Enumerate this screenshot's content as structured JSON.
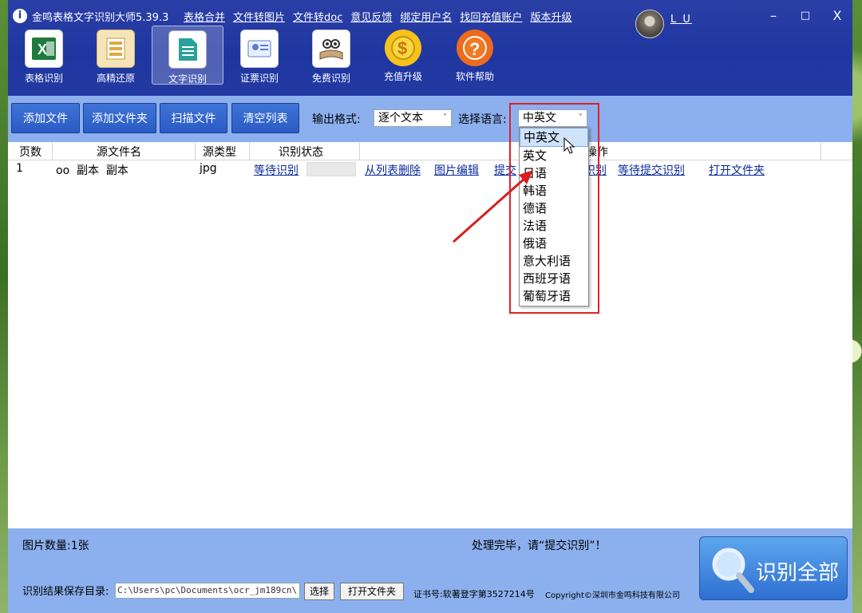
{
  "app": {
    "title": "金鸣表格文字识别大师5.39.3",
    "menu": [
      "表格合并",
      "文件转图片",
      "文件转doc",
      "意见反馈",
      "绑定用户名",
      "找回充值账户",
      "版本升级"
    ],
    "username": "L U",
    "window_buttons": {
      "minimize": "–",
      "maximize": "□",
      "close": "X"
    }
  },
  "tools": [
    {
      "label": "表格识别",
      "icon": "excel-icon"
    },
    {
      "label": "高精还原",
      "icon": "restore-icon"
    },
    {
      "label": "文字识别",
      "icon": "text-doc-icon",
      "active": true
    },
    {
      "label": "证票识别",
      "icon": "id-card-icon"
    },
    {
      "label": "免费识别",
      "icon": "book-owl-icon"
    },
    {
      "label": "充值升级",
      "icon": "coin-icon"
    },
    {
      "label": "软件帮助",
      "icon": "help-icon"
    }
  ],
  "actions": {
    "add_file": "添加文件",
    "add_folder": "添加文件夹",
    "scan_file": "扫描文件",
    "clear_list": "清空列表",
    "output_format_label": "输出格式:",
    "output_format_value": "逐个文本",
    "language_label": "选择语言:",
    "language_value": "中英文"
  },
  "table": {
    "headers": [
      "页数",
      "源文件名",
      "源类型",
      "识别状态",
      "操作"
    ],
    "rows": [
      {
        "page": "1",
        "name": "oo  副本  副本",
        "type": "jpg",
        "status": "等待识别",
        "ops": [
          "从列表删除",
          "图片编辑",
          "提交",
          "识别",
          "等待提交识别",
          "打开文件夹"
        ]
      }
    ]
  },
  "language_options": [
    "中英文",
    "英文",
    "日语",
    "韩语",
    "德语",
    "法语",
    "俄语",
    "意大利语",
    "西班牙语",
    "葡萄牙语"
  ],
  "footer": {
    "image_count": "图片数量:1张",
    "status_message": "处理完毕，请“提交识别”！",
    "save_dir_label": "识别结果保存目录:",
    "save_dir_value": "C:\\Users\\pc\\Documents\\ocr_jm189cn\\",
    "choose_button": "选择",
    "open_folder_button": "打开文件夹",
    "cert_no": "证书号:软著登字第3527214号",
    "copyright": "Copyright©深圳市金鸣科技有限公司",
    "recognize_all": "识别全部"
  },
  "colors": {
    "title_bar": "#1f36a0",
    "toolbar": "#8cb0ee",
    "highlight_box": "#e0202a",
    "link": "#0a2a9a"
  }
}
